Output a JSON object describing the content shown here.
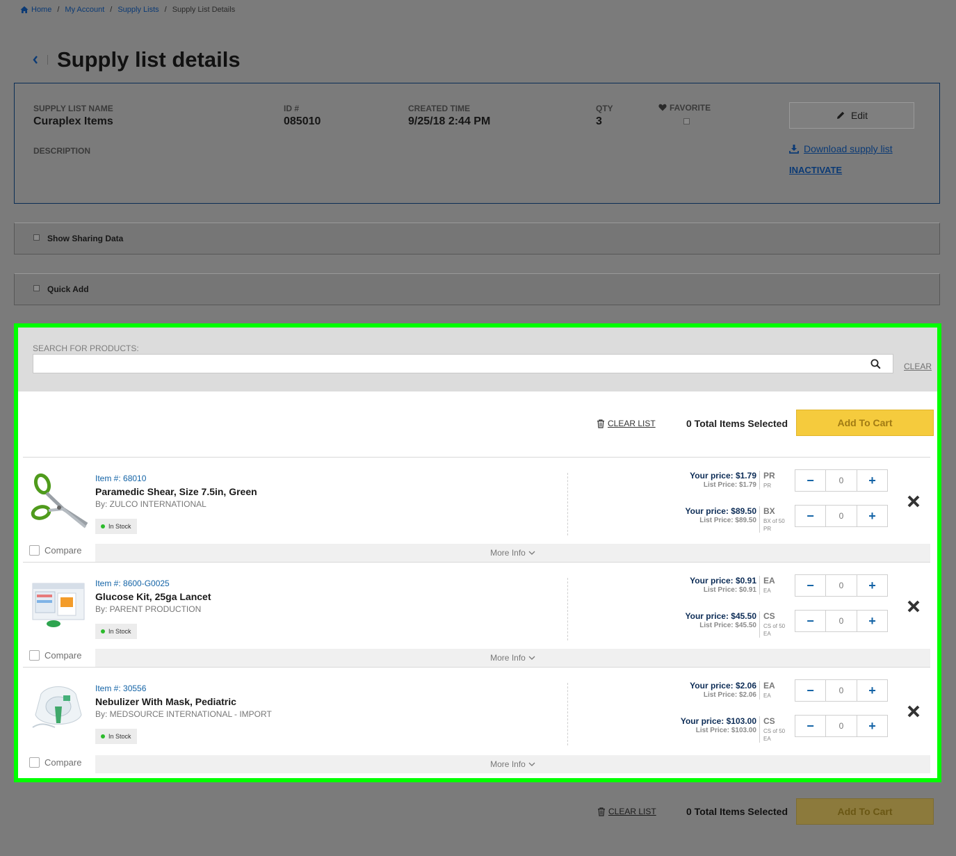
{
  "breadcrumb": {
    "home": "Home",
    "my_account": "My Account",
    "supply_lists": "Supply Lists",
    "current": "Supply List Details"
  },
  "page_title": "Supply list details",
  "info": {
    "name_label": "SUPPLY LIST NAME",
    "name_value": "Curaplex Items",
    "id_label": "ID #",
    "id_value": "085010",
    "created_label": "CREATED TIME",
    "created_value": "9/25/18 2:44 PM",
    "qty_label": "QTY",
    "qty_value": "3",
    "favorite_label": "FAVORITE",
    "description_label": "DESCRIPTION",
    "edit_label": "Edit",
    "download_label": "Download supply list",
    "inactivate_label": "INACTIVATE"
  },
  "toggles": {
    "sharing": "Show Sharing Data",
    "quick_add": "Quick Add"
  },
  "search": {
    "label": "SEARCH FOR PRODUCTS:",
    "placeholder": "",
    "clear": "CLEAR"
  },
  "actions": {
    "clear_list": "CLEAR LIST",
    "total_selected": "0 Total Items Selected",
    "add_to_cart": "Add To Cart"
  },
  "common": {
    "in_stock": "In Stock",
    "compare": "Compare",
    "more_info": "More Info"
  },
  "items": [
    {
      "number": "Item #: 68010",
      "name": "Paramedic Shear, Size 7.5in, Green",
      "brand": "By: ZULCO INTERNATIONAL",
      "prices": [
        {
          "your": "Your price: $1.79",
          "list": "List Price: $1.79",
          "uom": "PR",
          "uom_sub": "PR",
          "qty": "0"
        },
        {
          "your": "Your price: $89.50",
          "list": "List Price: $89.50",
          "uom": "BX",
          "uom_sub": "BX of 50",
          "uom_sub2": "PR",
          "qty": "0"
        }
      ]
    },
    {
      "number": "Item #: 8600-G0025",
      "name": "Glucose Kit, 25ga Lancet",
      "brand": "By: PARENT PRODUCTION",
      "prices": [
        {
          "your": "Your price: $0.91",
          "list": "List Price: $0.91",
          "uom": "EA",
          "uom_sub": "EA",
          "qty": "0"
        },
        {
          "your": "Your price: $45.50",
          "list": "List Price: $45.50",
          "uom": "CS",
          "uom_sub": "CS of 50",
          "uom_sub2": "EA",
          "qty": "0"
        }
      ]
    },
    {
      "number": "Item #: 30556",
      "name": "Nebulizer With Mask, Pediatric",
      "brand": "By: MEDSOURCE INTERNATIONAL - IMPORT",
      "prices": [
        {
          "your": "Your price: $2.06",
          "list": "List Price: $2.06",
          "uom": "EA",
          "uom_sub": "EA",
          "qty": "0"
        },
        {
          "your": "Your price: $103.00",
          "list": "List Price: $103.00",
          "uom": "CS",
          "uom_sub": "CS of 50",
          "uom_sub2": "EA",
          "qty": "0"
        }
      ]
    }
  ],
  "colors": {
    "highlight": "#00ff00",
    "primary": "#0b3a75",
    "cart": "#f5cb3d",
    "in_stock": "#2dbb2d"
  }
}
